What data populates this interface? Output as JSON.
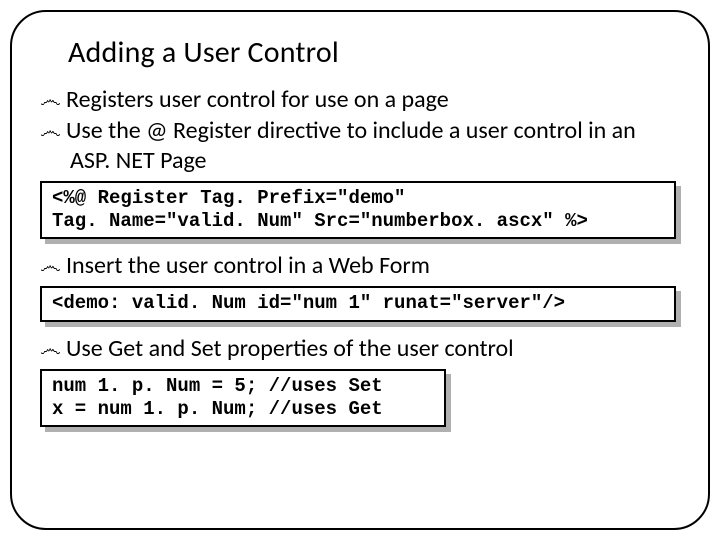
{
  "title": "Adding a User Control",
  "bullets": {
    "b1": "Registers user control for use on a page",
    "b2": "Use the @ Register directive to include a user control in an ASP. NET Page",
    "b3": "Insert the user control in a Web Form",
    "b4": "Use Get and Set properties of the user control"
  },
  "code": {
    "c1": "<%@ Register Tag. Prefix=\"demo\"\nTag. Name=\"valid. Num\" Src=\"numberbox. ascx\" %>",
    "c2": "<demo: valid. Num id=\"num 1\" runat=\"server\"/>",
    "c3": "num 1. p. Num = 5; //uses Set\nx = num 1. p. Num; //uses Get"
  },
  "glyphs": {
    "bullet": "෴"
  }
}
